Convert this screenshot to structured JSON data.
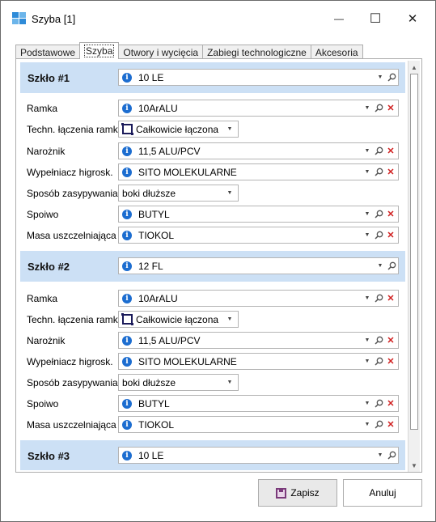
{
  "window": {
    "title": "Szyba [1]",
    "minimize_glyph": "—",
    "maximize_glyph": "☐",
    "close_glyph": "✕"
  },
  "tabs": [
    {
      "label": "Podstawowe",
      "active": false
    },
    {
      "label": "Szyba",
      "active": true
    },
    {
      "label": "Otwory i wycięcia",
      "active": false
    },
    {
      "label": "Zabiegi technologiczne",
      "active": false
    },
    {
      "label": "Akcesoria",
      "active": false
    }
  ],
  "labels": {
    "ramka": "Ramka",
    "techn": "Techn. łączenia ramki",
    "naroznik": "Narożnik",
    "wypelniacz": "Wypełniacz higrosk.",
    "sposob": "Sposób zasypywania",
    "spoiwo": "Spoiwo",
    "masa": "Masa uszczelniająca"
  },
  "glasses": [
    {
      "header": "Szkło #1",
      "glass_value": "10 LE",
      "ramka": "10ArALU",
      "techn": "Całkowicie łączona",
      "naroznik": "11,5 ALU/PCV",
      "wypelniacz": "SITO MOLEKULARNE",
      "sposob": "boki dłuższe",
      "spoiwo": "BUTYL",
      "masa": "TIOKOL"
    },
    {
      "header": "Szkło #2",
      "glass_value": "12 FL",
      "ramka": "10ArALU",
      "techn": "Całkowicie łączona",
      "naroznik": "11,5 ALU/PCV",
      "wypelniacz": "SITO MOLEKULARNE",
      "sposob": "boki dłuższe",
      "spoiwo": "BUTYL",
      "masa": "TIOKOL"
    },
    {
      "header": "Szkło #3",
      "glass_value": "10 LE"
    }
  ],
  "buttons": {
    "save": "Zapisz",
    "cancel": "Anuluj"
  },
  "colors": {
    "header_band": "#cce0f5",
    "info_icon": "#1c6dd0",
    "clear_icon": "#d02020"
  }
}
